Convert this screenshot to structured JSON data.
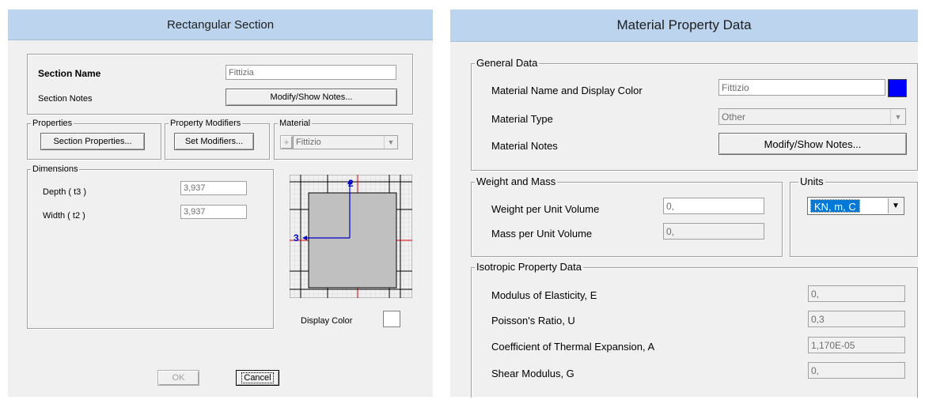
{
  "rect": {
    "title": "Rectangular Section",
    "section_name_label": "Section Name",
    "section_name_value": "Fittizia",
    "section_notes_label": "Section Notes",
    "modify_notes_button": "Modify/Show Notes...",
    "properties_group": "Properties",
    "section_properties_button": "Section Properties...",
    "modifiers_group": "Property Modifiers",
    "set_modifiers_button": "Set Modifiers...",
    "material_group": "Material",
    "material_add_button": "+",
    "material_value": "Fittizio",
    "dimensions_group": "Dimensions",
    "depth_label": "Depth ( t3 )",
    "depth_value": "3,937",
    "width_label": "Width ( t2 )",
    "width_value": "3,937",
    "axis_2_label": "2",
    "axis_3_label": "3",
    "display_color_label": "Display Color",
    "display_color": "#ffffff",
    "ok_button": "OK",
    "cancel_button": "Cancel"
  },
  "mat": {
    "title": "Material Property Data",
    "general_group": "General Data",
    "name_label": "Material Name and Display Color",
    "name_value": "Fittizio",
    "display_color": "#0000ff",
    "type_label": "Material Type",
    "type_value": "Other",
    "notes_label": "Material Notes",
    "modify_notes_button": "Modify/Show Notes...",
    "weight_group": "Weight and Mass",
    "weight_label": "Weight per Unit Volume",
    "weight_value": "0,",
    "mass_label": "Mass per Unit Volume",
    "mass_value": "0,",
    "units_group": "Units",
    "units_value": "KN, m, C",
    "iso_group": "Isotropic Property Data",
    "modulus_label": "Modulus of Elasticity,  E",
    "modulus_value": "0,",
    "poisson_label": "Poisson's Ratio,  U",
    "poisson_value": "0,3",
    "thermal_label": "Coefficient of Thermal Expansion,  A",
    "thermal_value": "1,170E-05",
    "shear_label": "Shear Modulus,  G",
    "shear_value": "0,"
  },
  "colors": {
    "titlebar": "#bcd4ee",
    "section_fill": "#c0c0c0",
    "axis_blue": "#0000c8",
    "axis_red": "#d00000"
  }
}
